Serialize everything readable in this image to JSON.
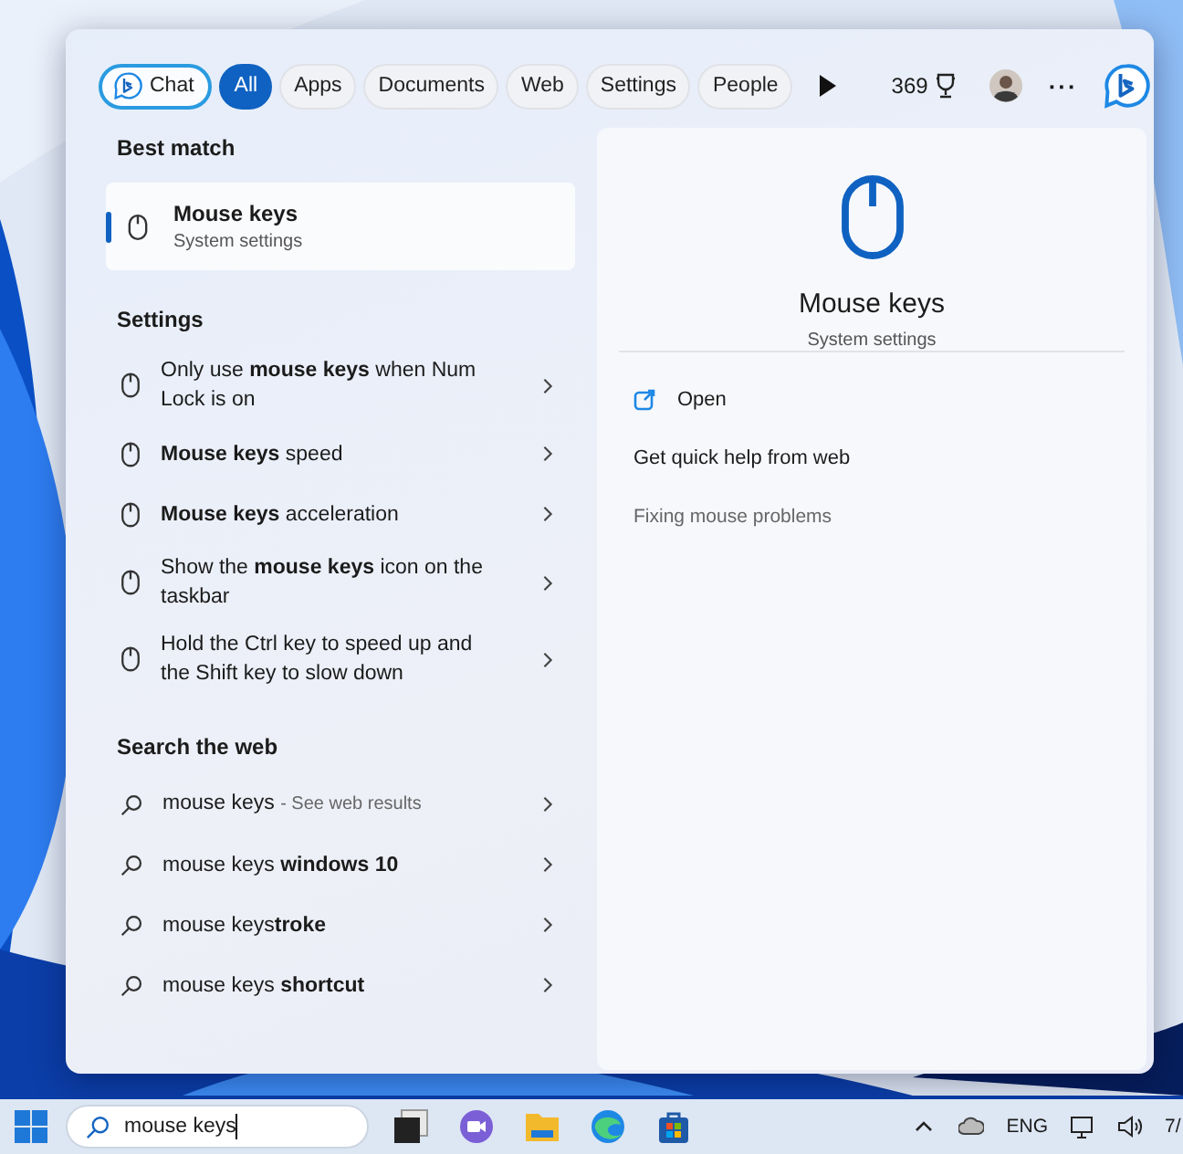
{
  "filters": [
    {
      "label": "Chat",
      "kind": "chat",
      "selected": false
    },
    {
      "label": "All",
      "kind": "filter",
      "selected": true
    },
    {
      "label": "Apps",
      "kind": "filter",
      "selected": false
    },
    {
      "label": "Documents",
      "kind": "filter",
      "selected": false
    },
    {
      "label": "Web",
      "kind": "filter",
      "selected": false
    },
    {
      "label": "Settings",
      "kind": "filter",
      "selected": false
    },
    {
      "label": "People",
      "kind": "filter",
      "selected": false
    }
  ],
  "rewards_points": "369",
  "more_label": "···",
  "best_match": {
    "heading": "Best match",
    "title": "Mouse keys",
    "subtitle": "System settings",
    "selected": true
  },
  "sections": [
    {
      "heading": "Settings",
      "items": [
        {
          "text": "Only use **mouse keys** when Num Lock is on",
          "kind": "setting"
        },
        {
          "text": "**Mouse keys** speed",
          "kind": "setting"
        },
        {
          "text": "**Mouse keys** acceleration",
          "kind": "setting"
        },
        {
          "text": "Show the **mouse keys** icon on the taskbar",
          "kind": "setting"
        },
        {
          "text": "Hold the Ctrl key to speed up and the Shift key to slow down",
          "kind": "setting"
        }
      ]
    },
    {
      "heading": "Search the web",
      "items": [
        {
          "text": "mouse keys",
          "hint": "- See web results",
          "kind": "search"
        },
        {
          "text": "mouse keys **windows 10**",
          "kind": "search"
        },
        {
          "text": "mouse keys**troke**",
          "kind": "search"
        },
        {
          "text": "mouse keys **shortcut**",
          "kind": "search"
        }
      ]
    }
  ],
  "preview": {
    "title": "Mouse keys",
    "subtitle": "System settings",
    "actions": [
      {
        "label": "Open",
        "kind": "open"
      },
      {
        "label": "Get quick help from web",
        "kind": "heading"
      },
      {
        "label": "Fixing mouse problems",
        "kind": "link"
      }
    ]
  },
  "taskbar": {
    "search_value": "mouse keys",
    "language": "ENG",
    "clock": "7/"
  }
}
